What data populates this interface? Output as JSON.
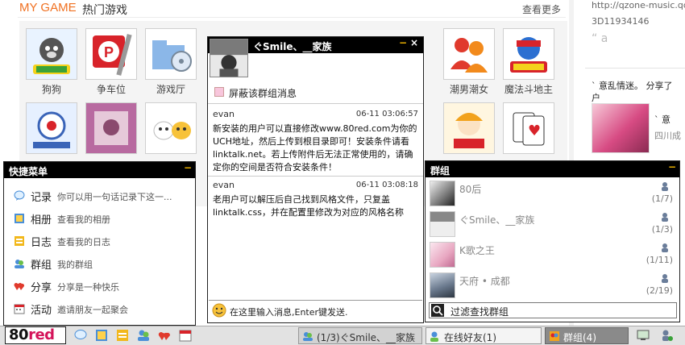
{
  "background": {
    "brand": "MY GAME",
    "section_title": "热门游戏",
    "more_link": "查看更多",
    "games": [
      {
        "label": "狗狗"
      },
      {
        "label": "争车位"
      },
      {
        "label": "游戏厅"
      },
      {
        "label": "潮男潮女"
      },
      {
        "label": "魔法斗地主"
      }
    ],
    "right_pane": {
      "url": "http://qzone-music.qq",
      "id_text": "3D11934146",
      "quote_text": "a",
      "user_line1": "` 意乱情迷。 分享了",
      "user_line2": "户",
      "user_name": "` 意",
      "location": "四川成"
    }
  },
  "quick_menu": {
    "title": "快捷菜单",
    "items": [
      {
        "label": "记录",
        "desc": "你可以用一句话记录下这一..."
      },
      {
        "label": "相册",
        "desc": "查看我的相册"
      },
      {
        "label": "日志",
        "desc": "查看我的日志"
      },
      {
        "label": "群组",
        "desc": "我的群组"
      },
      {
        "label": "分享",
        "desc": "分享是一种快乐"
      },
      {
        "label": "活动",
        "desc": "邀请朋友一起聚会"
      }
    ]
  },
  "chat": {
    "title": "ぐSmile、__家族",
    "mute_label": "屏蔽该群组消息",
    "messages": [
      {
        "sender": "evan",
        "time": "06-11 03:06:57",
        "text": "新安装的用户可以直接修改www.80red.com为你的UCH地址，然后上传到根目录即可！安装条件请看linktalk.net。若上传附件后无法正常使用的，请确定你的空间是否符合安装条件！"
      },
      {
        "sender": "evan",
        "time": "06-11 03:08:18",
        "text": "老用户可以解压后自己找到风格文件，只复盖linktalk.css，并在配置里修改为对应的风格名称"
      }
    ],
    "input_placeholder": "在这里输入消息,Enter键发送."
  },
  "groups": {
    "title": "群组",
    "items": [
      {
        "name": "80后",
        "count": "(1/7)"
      },
      {
        "name": "ぐSmile、__家族",
        "count": "(1/3)"
      },
      {
        "name": "K歌之王",
        "count": "(1/11)"
      },
      {
        "name": "天府 • 成都",
        "count": "(2/19)"
      }
    ],
    "filter_label": "过滤查找群组"
  },
  "taskbar": {
    "logo_a": "80",
    "logo_b": "red",
    "chat_tab": "(1/3)ぐSmile、__家族",
    "friends_tab": "在线好友(1)",
    "groups_tab": "群组(4)"
  },
  "colors": {
    "accent_orange": "#f07020",
    "brand_red": "#d4145a",
    "minimize_yellow": "#f5b800"
  }
}
